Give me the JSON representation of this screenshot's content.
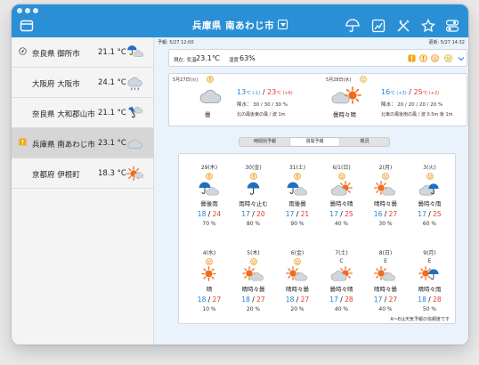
{
  "titlebar": {
    "location": "兵庫県 南あわじ市"
  },
  "cities": [
    {
      "name": "奈良県 御所市",
      "temp": "21.1 °C",
      "icon": "umbrella-cloud-icon",
      "prefix": "location-icon"
    },
    {
      "name": "大阪府 大阪市",
      "temp": "24.1 °C",
      "icon": "cloud-rain-icon",
      "prefix": ""
    },
    {
      "name": "奈良県 大和郡山市",
      "temp": "21.1 °C",
      "icon": "umbrella-closed-icon",
      "prefix": ""
    },
    {
      "name": "兵庫県 南あわじ市",
      "temp": "23.1 °C",
      "icon": "cloud-icon",
      "prefix": "alert-icon"
    },
    {
      "name": "京都府 伊根町",
      "temp": "18.3 °C",
      "icon": "sun-cloud-icon",
      "prefix": ""
    }
  ],
  "update": {
    "left": "予報: 5/27 12:00",
    "right": "更新: 5/27 14:32"
  },
  "current": {
    "label": "現在: 気温",
    "temp": "23.1℃",
    "hum_label": "湿度",
    "humidity": "63%"
  },
  "today": {
    "date": "5月27日(火)",
    "weather": "曇",
    "lo": "13",
    "lo_diff": "℃ (-1)",
    "hi": "23",
    "hi_diff": "℃ (+6)",
    "rain_label": "降水：",
    "rain": "30 / 30 / 30 %",
    "wind": "北の風後東の風 / 波 1m"
  },
  "tomorrow": {
    "date": "5月28日(水)",
    "weather": "曇時々晴",
    "lo": "16",
    "lo_diff": "℃ (+3)",
    "hi": "25",
    "hi_diff": "℃ (+2)",
    "rain_label": "降水：",
    "rain": "20 / 20 / 20 / 20 %",
    "wind": "北東の風後南の風 / 波 0.5m 後 1m"
  },
  "tabs": [
    "時間別予報",
    "週間予報",
    "概況"
  ],
  "week": [
    {
      "date": "29(木)",
      "rank": "!",
      "weather": "曇後雨",
      "lo": "18",
      "hi": "24",
      "pop": "70 %",
      "icon": "umbrella-cloud-icon"
    },
    {
      "date": "30(金)",
      "rank": "!",
      "weather": "雨時々止む",
      "lo": "17",
      "hi": "20",
      "pop": "80 %",
      "icon": "umbrella-icon"
    },
    {
      "date": "31(土)",
      "rank": "!",
      "weather": "雨後曇",
      "lo": "17",
      "hi": "21",
      "pop": "90 %",
      "icon": "umbrella-cloud-icon"
    },
    {
      "date": "6/1(日)",
      "rank": "",
      "weather": "曇時々晴",
      "lo": "17",
      "hi": "25",
      "pop": "40 %",
      "icon": "cloud-sun-icon"
    },
    {
      "date": "2(月)",
      "rank": "",
      "weather": "晴時々曇",
      "lo": "16",
      "hi": "27",
      "pop": "30 %",
      "icon": "sun-cloud-icon"
    },
    {
      "date": "3(火)",
      "rank": "",
      "weather": "曇時々雨",
      "lo": "17",
      "hi": "25",
      "pop": "60 %",
      "icon": "cloud-umbrella-icon"
    },
    {
      "date": "4(水)",
      "rank": "",
      "weather": "晴",
      "lo": "18",
      "hi": "27",
      "pop": "10 %",
      "icon": "sun-icon"
    },
    {
      "date": "5(木)",
      "rank": "",
      "weather": "晴時々曇",
      "lo": "18",
      "hi": "27",
      "pop": "20 %",
      "icon": "sun-cloud-icon"
    },
    {
      "date": "6(金)",
      "rank": "",
      "weather": "晴時々曇",
      "lo": "18",
      "hi": "27",
      "pop": "20 %",
      "icon": "sun-cloud-icon"
    },
    {
      "date": "7(土)",
      "rank": "C",
      "weather": "曇時々晴",
      "lo": "17",
      "hi": "28",
      "pop": "40 %",
      "icon": "cloud-sun-icon"
    },
    {
      "date": "8(日)",
      "rank": "E",
      "weather": "晴時々曇",
      "lo": "17",
      "hi": "27",
      "pop": "40 %",
      "icon": "sun-cloud-icon"
    },
    {
      "date": "9(月)",
      "rank": "E",
      "weather": "晴時々雨",
      "lo": "18",
      "hi": "28",
      "pop": "50 %",
      "icon": "sun-umbrella-icon"
    }
  ],
  "footnote": "A〜Eは天気予報の信頼度です",
  "colors": {
    "accent": "#2b8fd6",
    "low": "#1f7fd4",
    "high": "#e23b2b",
    "sun": "#f26a1b"
  }
}
